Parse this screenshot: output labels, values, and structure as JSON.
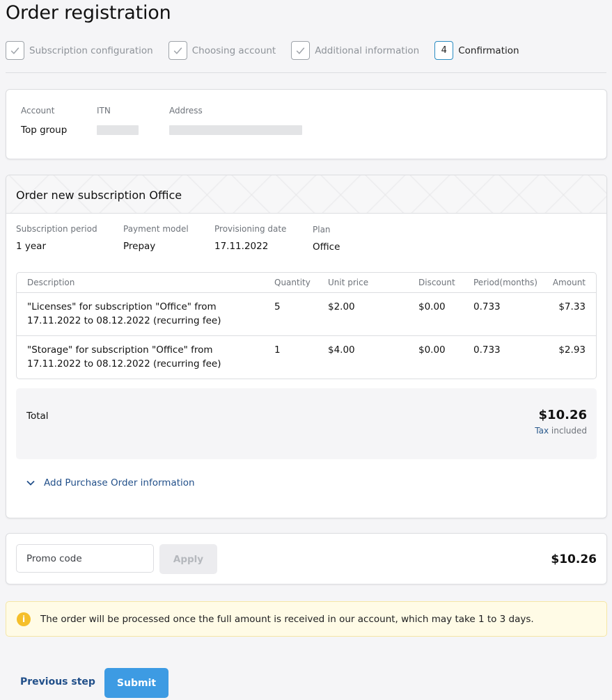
{
  "page": {
    "title": "Order registration"
  },
  "stepper": {
    "steps": [
      {
        "label": "Subscription configuration",
        "state": "done"
      },
      {
        "label": "Choosing account",
        "state": "done"
      },
      {
        "label": "Additional information",
        "state": "done"
      },
      {
        "label": "Confirmation",
        "state": "active",
        "number": "4"
      }
    ]
  },
  "account": {
    "account_label": "Account",
    "account_value": "Top group",
    "itn_label": "ITN",
    "address_label": "Address"
  },
  "order": {
    "title": "Order new subscription Office",
    "subscription_period_label": "Subscription period",
    "subscription_period_value": "1 year",
    "payment_model_label": "Payment model",
    "payment_model_value": "Prepay",
    "provisioning_date_label": "Provisioning date",
    "provisioning_date_value": "17.11.2022",
    "plan_label": "Plan",
    "plan_value": "Office",
    "table": {
      "headers": {
        "description": "Description",
        "quantity": "Quantity",
        "unit_price": "Unit price",
        "discount": "Discount",
        "period": "Period(months)",
        "amount": "Amount"
      },
      "rows": [
        {
          "description_line1": "\"Licenses\" for subscription \"Office\" from",
          "description_line2": "17.11.2022 to 08.12.2022 (recurring fee)",
          "quantity": "5",
          "unit_price": "$2.00",
          "discount": "$0.00",
          "period": "0.733",
          "amount": "$7.33"
        },
        {
          "description_line1": "\"Storage\" for subscription \"Office\" from",
          "description_line2": "17.11.2022 to 08.12.2022 (recurring fee)",
          "quantity": "1",
          "unit_price": "$4.00",
          "discount": "$0.00",
          "period": "0.733",
          "amount": "$2.93"
        }
      ]
    },
    "total_label": "Total",
    "total_value": "$10.26",
    "tax_link": "Tax",
    "tax_suffix": "included",
    "purchase_order_link": "Add Purchase Order information"
  },
  "promo": {
    "placeholder": "Promo code",
    "apply_label": "Apply",
    "total": "$10.26"
  },
  "notice": {
    "icon": "info-icon",
    "text": "The order will be processed once the full amount is received in our account, which may take 1 to 3 days."
  },
  "footer": {
    "previous_label": "Previous step",
    "submit_label": "Submit"
  },
  "colors": {
    "accent": "#3d9be3",
    "link": "#22508a",
    "notice_bg": "#fffbe6",
    "notice_icon": "#f5bf2a"
  }
}
